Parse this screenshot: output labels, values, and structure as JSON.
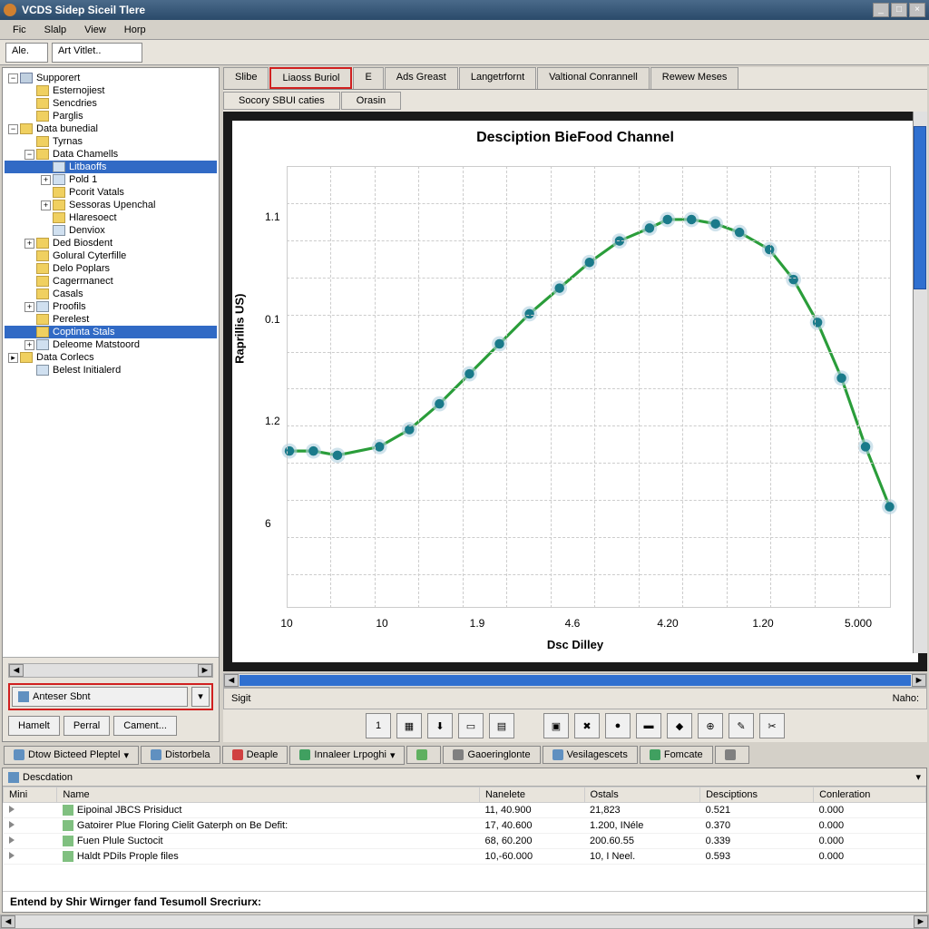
{
  "title": "VCDS Sidep Siceil Tlere",
  "menus": [
    "Fic",
    "Slalp",
    "View",
    "Horp"
  ],
  "toolbar_combo1": "Ale.",
  "toolbar_combo2": "Art Vitlet..",
  "tree": [
    {
      "d": 0,
      "t": "-",
      "i": "root",
      "label": "Supporert"
    },
    {
      "d": 1,
      "t": "",
      "i": "folder",
      "label": "Esternojiest"
    },
    {
      "d": 1,
      "t": "",
      "i": "folder",
      "label": "Sencdries"
    },
    {
      "d": 1,
      "t": "",
      "i": "folder",
      "label": "Parglis"
    },
    {
      "d": 0,
      "t": "-",
      "i": "folder",
      "label": "Data bunedial"
    },
    {
      "d": 1,
      "t": "",
      "i": "folder",
      "label": "Tyrnas"
    },
    {
      "d": 1,
      "t": "-",
      "i": "folder",
      "label": "Data Chamells"
    },
    {
      "d": 2,
      "t": "",
      "i": "file",
      "label": "Litbaoffs",
      "sel": true
    },
    {
      "d": 2,
      "t": "+",
      "i": "file",
      "label": "Pold 1"
    },
    {
      "d": 2,
      "t": "",
      "i": "folder",
      "label": "Pcorit Vatals"
    },
    {
      "d": 2,
      "t": "+",
      "i": "folder",
      "label": "Sessoras Upenchal"
    },
    {
      "d": 2,
      "t": "",
      "i": "folder",
      "label": "Hlaresoect"
    },
    {
      "d": 2,
      "t": "",
      "i": "file",
      "label": "Denviox"
    },
    {
      "d": 1,
      "t": "+",
      "i": "folder",
      "label": "Ded Biosdent"
    },
    {
      "d": 1,
      "t": "",
      "i": "folder",
      "label": "Golural Cyterfille"
    },
    {
      "d": 1,
      "t": "",
      "i": "folder",
      "label": "Delo Poplars"
    },
    {
      "d": 1,
      "t": "",
      "i": "folder",
      "label": "Cagerrnanect"
    },
    {
      "d": 1,
      "t": "",
      "i": "folder",
      "label": "Casals"
    },
    {
      "d": 1,
      "t": "+",
      "i": "file",
      "label": "Proofils"
    },
    {
      "d": 1,
      "t": "",
      "i": "folder",
      "label": "Perelest"
    },
    {
      "d": 1,
      "t": "",
      "i": "folder",
      "label": "Coptinta Stals",
      "sel": true
    },
    {
      "d": 1,
      "t": "+",
      "i": "file",
      "label": "Deleome Matstoord"
    },
    {
      "d": 0,
      "t": ">",
      "i": "folder",
      "label": "Data Corlecs"
    },
    {
      "d": 1,
      "t": "",
      "i": "file",
      "label": "Belest Initialerd"
    }
  ],
  "anteser_label": "Anteser Sbnt",
  "bottom_buttons": [
    "Hamelt",
    "Perral",
    "Cament..."
  ],
  "content_tabs": [
    "Slibe",
    "Liaoss Buriol",
    "E",
    "Ads Greast",
    "Langetrfornt",
    "Valtional Conrannell",
    "Rewew Meses"
  ],
  "content_tab_active": 1,
  "sub_tabs": [
    "Socory SBUI caties",
    "Orasin"
  ],
  "chart_data": {
    "type": "line",
    "title": "Desciption BieFood Channel",
    "xlabel": "Dsc Dilley",
    "ylabel": "Raprillis US)",
    "xticks": [
      "10",
      "10",
      "1.9",
      "4.6",
      "4.20",
      "1.20",
      "5.000"
    ],
    "yticks": [
      "1.1",
      "0.1",
      "1.2",
      "6"
    ],
    "x": [
      0.0,
      0.04,
      0.08,
      0.15,
      0.2,
      0.25,
      0.3,
      0.35,
      0.4,
      0.45,
      0.5,
      0.55,
      0.6,
      0.63,
      0.67,
      0.71,
      0.75,
      0.8,
      0.84,
      0.88,
      0.92,
      0.96,
      1.0
    ],
    "y": [
      0.35,
      0.35,
      0.34,
      0.36,
      0.4,
      0.46,
      0.53,
      0.6,
      0.67,
      0.73,
      0.79,
      0.84,
      0.87,
      0.89,
      0.89,
      0.88,
      0.86,
      0.82,
      0.75,
      0.65,
      0.52,
      0.36,
      0.22
    ]
  },
  "status_left": "Sigit",
  "status_right": "Naho:",
  "bottom_tabs": [
    {
      "icon": "#6090c0",
      "label": "Dtow Bicteed Pleptel",
      "dd": true
    },
    {
      "icon": "#6090c0",
      "label": "Distorbela"
    },
    {
      "icon": "#d04040",
      "label": "Deaple"
    },
    {
      "icon": "#40a060",
      "label": "Innaleer Lrpoghi",
      "dd": true
    },
    {
      "icon": "#60b060",
      "label": ""
    },
    {
      "icon": "#808080",
      "label": "Gaoeringlonte"
    },
    {
      "icon": "#6090c0",
      "label": "Vesilagescets"
    },
    {
      "icon": "#40a060",
      "label": "Fomcate"
    },
    {
      "icon": "#808080",
      "label": ""
    }
  ],
  "desc_label": "Descdation",
  "table": {
    "cols": [
      "Mini",
      "Name",
      "Nanelete",
      "Ostals",
      "Desciptions",
      "Conleration"
    ],
    "rows": [
      [
        "",
        "Eipoinal JBCS Prisiduct",
        "11, 40.900",
        "21,823",
        "0.521",
        "0.000"
      ],
      [
        "",
        "Gatoirer Plue Floring Cielit Gaterph on Be Defit:",
        "17, 40.600",
        "1.200, INéle",
        "0.370",
        "0.000"
      ],
      [
        "",
        "Fuen Plule Suctocit",
        "68, 60.200",
        "200.60.55",
        "0.339",
        "0.000"
      ],
      [
        "",
        "Haldt PDils Prople files",
        "10,-60.000",
        "10, I Neel.",
        "0.593",
        "0.000"
      ]
    ]
  },
  "footer_text": "Entend by Shir Wirnger fand Tesumoll Srecriurx:"
}
